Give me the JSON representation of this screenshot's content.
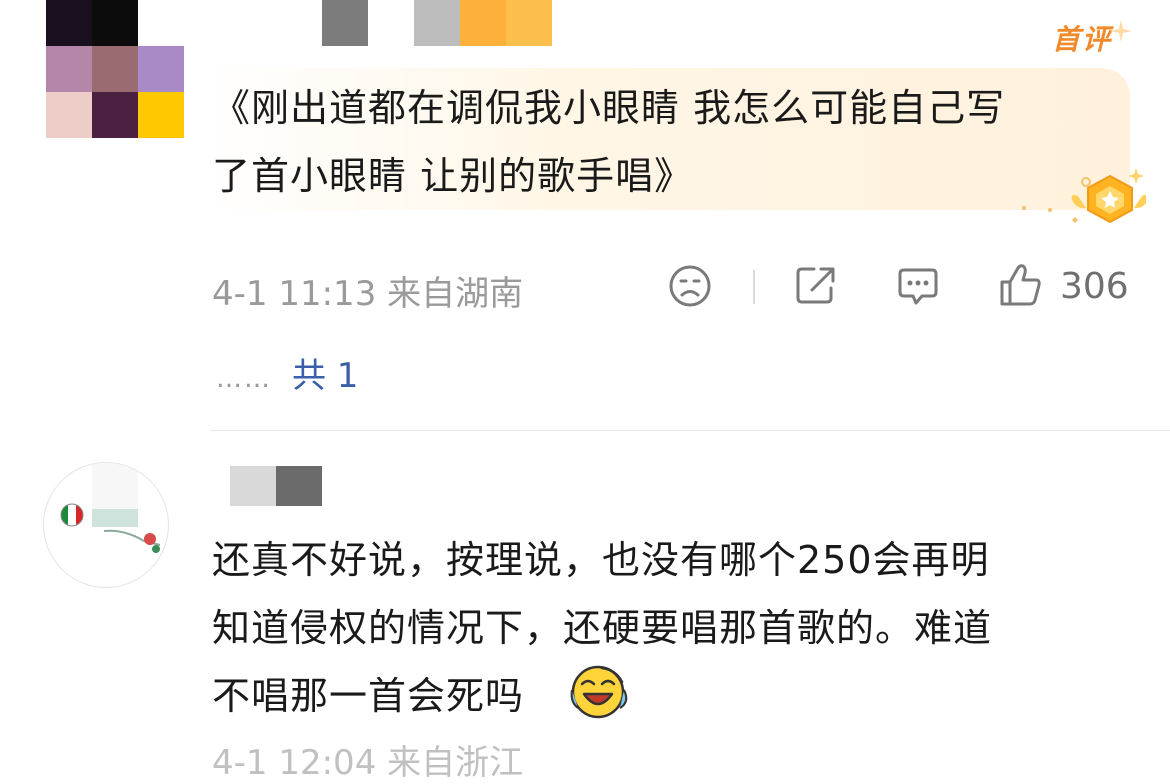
{
  "comment1": {
    "badge": "首评",
    "text_line1": "《刚出道都在调侃我小眼睛 我怎么可能自己写",
    "text_line2": "了首小眼睛 让别的歌手唱》",
    "meta": "4-1 11:13 来自湖南",
    "likes": "306",
    "replies_dots": "……",
    "replies_text": "共 1"
  },
  "comment2": {
    "text_line1": "还真不好说，按理说，也没有哪个250会再明",
    "text_line2": "知道侵权的情况下，还硬要唱那首歌的。难道",
    "text_line3": "不唱那一首会死吗",
    "emoji": "laughing-crying-emoji",
    "meta_partial": "4-1 12:04 来自浙江"
  },
  "icons": [
    "sad-face-icon",
    "share-icon",
    "comment-icon",
    "thumbs-up-icon",
    "gold-medal-icon"
  ],
  "colors": {
    "accent_orange": "#f08a2a",
    "link_blue": "#3b5fa8",
    "highlight_bg": "#fff1dc",
    "meta_gray": "#9a9a9a"
  }
}
